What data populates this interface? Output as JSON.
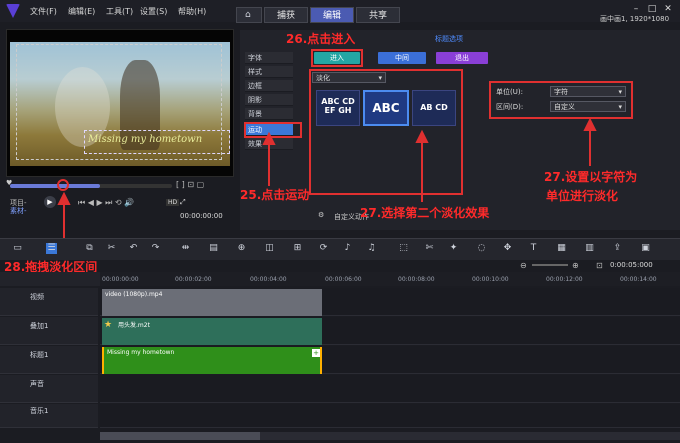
{
  "menu": [
    "文件(F)",
    "编辑(E)",
    "工具(T)",
    "设置(S)",
    "帮助(H)"
  ],
  "tabs": [
    "捕获",
    "编辑",
    "共享"
  ],
  "status": "画中画1, 1920*1080",
  "preview": {
    "subtitle_text": "Missing my hometown",
    "project_label": "项目-",
    "clip_label": "素材-",
    "timecode": "00:00:00:00",
    "hd_label": "HD"
  },
  "title_options": {
    "header": "标题选项",
    "enter": "进入",
    "middle": "中间",
    "exit": "退出"
  },
  "nav": [
    "字体",
    "样式",
    "边框",
    "阴影",
    "背景",
    "运动",
    "效果"
  ],
  "effect_select": "淡化",
  "presets": [
    {
      "line1": "ABC CD",
      "line2": "EF GH"
    },
    {
      "line1": "ABC",
      "line2": ""
    },
    {
      "line1": "AB CD",
      "line2": ""
    }
  ],
  "unit": {
    "label": "单位(U):",
    "value": "字符"
  },
  "interval": {
    "label": "区间(D):",
    "value": "自定义"
  },
  "custom_action": "自定义动作",
  "annotations": {
    "a26": "26.点击进入",
    "a25": "25.点击运动",
    "a27a": "27.选择第二个淡化效果",
    "a27b_1": "27.设置以字符为",
    "a27b_2": "单位进行淡化",
    "a28": "28.拖拽淡化区间"
  },
  "zoom_time": "0:00:05:000",
  "ruler_ticks": [
    "00:00:00:00",
    "00:00:02:00",
    "00:00:04:00",
    "00:00:06:00",
    "00:00:08:00",
    "00:00:10:00",
    "00:00:12:00",
    "00:00:14:00"
  ],
  "tracks": [
    {
      "name": "视频",
      "clip": "video (1080p).mp4"
    },
    {
      "name": "叠加1",
      "clip": "用头发.m2t"
    },
    {
      "name": "标题1",
      "clip": "Missing my hometown"
    },
    {
      "name": "声音",
      "clip": ""
    },
    {
      "name": "音乐1",
      "clip": ""
    }
  ],
  "colors": {
    "accent": "#3b78d8",
    "annotation": "#e03030",
    "enter": "#23a6a4",
    "middle": "#3b6fd8",
    "exit": "#8a3fd6",
    "title_clip": "#2f8f1a",
    "video_clip": "#6b6e77",
    "overlay_clip": "#2e6f5a"
  }
}
